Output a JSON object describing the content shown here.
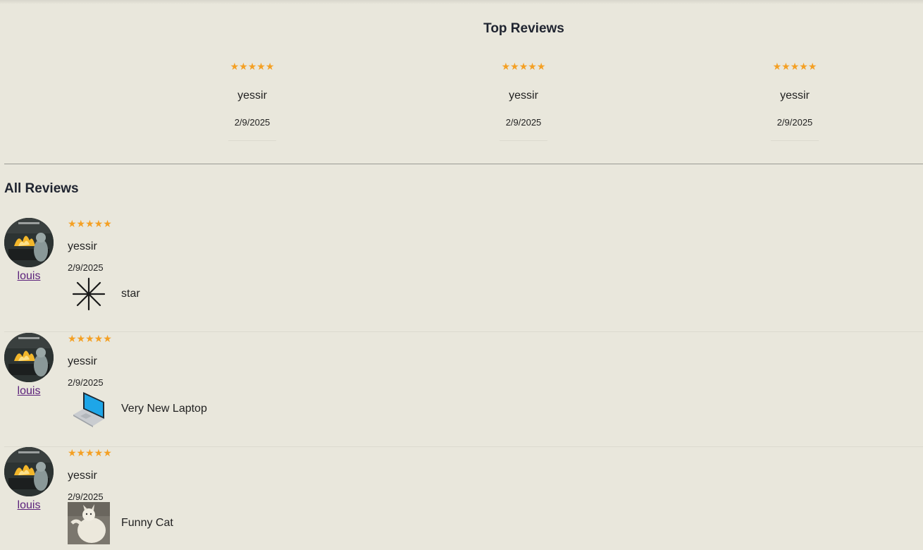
{
  "top_reviews": {
    "heading": "Top Reviews",
    "cards": [
      {
        "stars": "★★★★★",
        "title": "yessir",
        "date": "2/9/2025"
      },
      {
        "stars": "★★★★★",
        "title": "yessir",
        "date": "2/9/2025"
      },
      {
        "stars": "★★★★★",
        "title": "yessir",
        "date": "2/9/2025"
      }
    ]
  },
  "all_reviews": {
    "heading": "All Reviews",
    "items": [
      {
        "user": "louis",
        "stars": "★★★★★",
        "rating": 5,
        "title": "yessir",
        "date": "2/9/2025",
        "product": "star",
        "product_icon": "star-burst-icon"
      },
      {
        "user": "louis",
        "stars": "★★★★★",
        "rating": 5,
        "title": "yessir",
        "date": "2/9/2025",
        "product": "Very New Laptop",
        "product_icon": "laptop-icon"
      },
      {
        "user": "louis",
        "stars": "★★★★★",
        "rating": 5,
        "title": "yessir",
        "date": "2/9/2025",
        "product": "Funny Cat",
        "product_icon": "cat-photo"
      }
    ]
  },
  "colors": {
    "background": "#e9e7dc",
    "star": "#f4a024",
    "link": "#5a1f7a",
    "heading": "#1f2430"
  }
}
